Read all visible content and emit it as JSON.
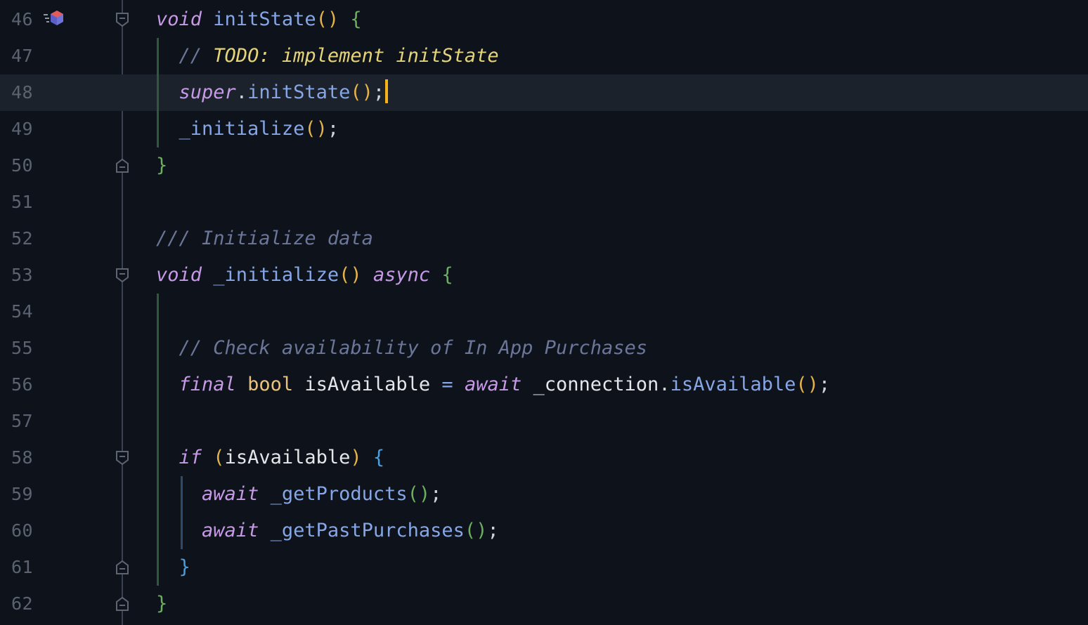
{
  "editor": {
    "language": "dart",
    "current_line": "48",
    "lines": [
      {
        "number": "46",
        "tokens": [
          [
            "kw",
            "void"
          ],
          [
            "id",
            " "
          ],
          [
            "fn",
            "initState"
          ],
          [
            "pY",
            "()"
          ],
          [
            "id",
            " "
          ],
          [
            "pG",
            "{"
          ]
        ]
      },
      {
        "number": "47",
        "tokens": [
          [
            "id",
            "  "
          ],
          [
            "cm",
            "// "
          ],
          [
            "todo",
            "TODO: implement initState"
          ]
        ]
      },
      {
        "number": "48",
        "tokens": [
          [
            "id",
            "  "
          ],
          [
            "kw",
            "super"
          ],
          [
            "punc",
            "."
          ],
          [
            "fn",
            "initState"
          ],
          [
            "pY",
            "()"
          ],
          [
            "punc",
            ";"
          ]
        ]
      },
      {
        "number": "49",
        "tokens": [
          [
            "id",
            "  "
          ],
          [
            "fn",
            "_initialize"
          ],
          [
            "pY",
            "()"
          ],
          [
            "punc",
            ";"
          ]
        ]
      },
      {
        "number": "50",
        "tokens": [
          [
            "pG",
            "}"
          ]
        ]
      },
      {
        "number": "51",
        "tokens": []
      },
      {
        "number": "52",
        "tokens": [
          [
            "cm",
            "/// Initialize data"
          ]
        ]
      },
      {
        "number": "53",
        "tokens": [
          [
            "kw",
            "void"
          ],
          [
            "id",
            " "
          ],
          [
            "fn",
            "_initialize"
          ],
          [
            "pY",
            "()"
          ],
          [
            "id",
            " "
          ],
          [
            "kw",
            "async"
          ],
          [
            "id",
            " "
          ],
          [
            "pG",
            "{"
          ]
        ]
      },
      {
        "number": "54",
        "tokens": []
      },
      {
        "number": "55",
        "tokens": [
          [
            "id",
            "  "
          ],
          [
            "cm",
            "// Check availability of In App Purchases"
          ]
        ]
      },
      {
        "number": "56",
        "tokens": [
          [
            "id",
            "  "
          ],
          [
            "kw",
            "final"
          ],
          [
            "id",
            " "
          ],
          [
            "type",
            "bool"
          ],
          [
            "id",
            " isAvailable "
          ],
          [
            "fn",
            "="
          ],
          [
            "id",
            " "
          ],
          [
            "kw",
            "await"
          ],
          [
            "id",
            " _connection"
          ],
          [
            "punc",
            "."
          ],
          [
            "fn",
            "isAvailable"
          ],
          [
            "pY",
            "()"
          ],
          [
            "punc",
            ";"
          ]
        ]
      },
      {
        "number": "57",
        "tokens": []
      },
      {
        "number": "58",
        "tokens": [
          [
            "id",
            "  "
          ],
          [
            "kw",
            "if"
          ],
          [
            "id",
            " "
          ],
          [
            "pY",
            "("
          ],
          [
            "id",
            "isAvailable"
          ],
          [
            "pY",
            ")"
          ],
          [
            "id",
            " "
          ],
          [
            "pB",
            "{"
          ]
        ]
      },
      {
        "number": "59",
        "tokens": [
          [
            "id",
            "    "
          ],
          [
            "kw",
            "await"
          ],
          [
            "id",
            " "
          ],
          [
            "fn",
            "_getProducts"
          ],
          [
            "pG",
            "()"
          ],
          [
            "punc",
            ";"
          ]
        ]
      },
      {
        "number": "60",
        "tokens": [
          [
            "id",
            "    "
          ],
          [
            "kw",
            "await"
          ],
          [
            "id",
            " "
          ],
          [
            "fn",
            "_getPastPurchases"
          ],
          [
            "pG",
            "()"
          ],
          [
            "punc",
            ";"
          ]
        ]
      },
      {
        "number": "61",
        "tokens": [
          [
            "id",
            "  "
          ],
          [
            "pB",
            "}"
          ]
        ]
      },
      {
        "number": "62",
        "tokens": [
          [
            "pG",
            "}"
          ]
        ]
      }
    ],
    "fold_markers": [
      {
        "line": "46",
        "kind": "open"
      },
      {
        "line": "50",
        "kind": "close"
      },
      {
        "line": "53",
        "kind": "open"
      },
      {
        "line": "58",
        "kind": "open"
      },
      {
        "line": "61",
        "kind": "close"
      },
      {
        "line": "62",
        "kind": "close"
      }
    ],
    "gutter_icon": {
      "line": "46",
      "icon": "override-method-icon"
    },
    "colors": {
      "background": "#0e121b",
      "current_line": "#1b222b",
      "cursor": "#f5b11a",
      "keyword": "#c69ae6",
      "function": "#86a6e6",
      "comment": "#6b7699",
      "todo": "#e5d47a"
    }
  }
}
